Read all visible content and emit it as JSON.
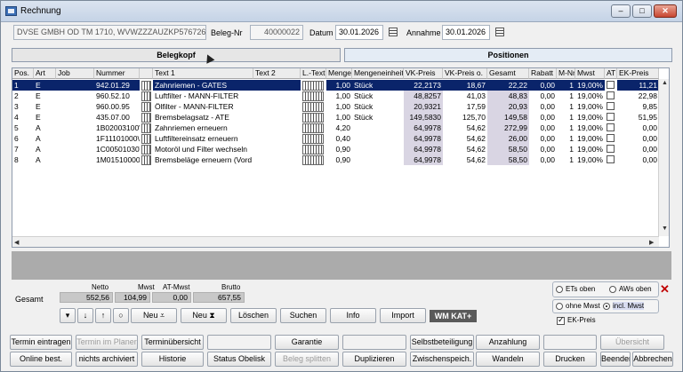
{
  "window": {
    "title": "Rechnung",
    "minimize": "–",
    "restore": "□",
    "close": "✕"
  },
  "header": {
    "customer": "DVSE GMBH OD TM 1710, WVWZZZAUZKP576726",
    "beleg_nr_label": "Beleg-Nr",
    "beleg_nr": "40000022",
    "datum_label": "Datum",
    "datum": "30.01.2026",
    "annahme_label": "Annahme",
    "annahme": "30.01.2026"
  },
  "tabs": {
    "belegkopf": "Belegkopf",
    "positionen": "Positionen"
  },
  "columns": [
    "Pos.",
    "Art",
    "Job",
    "Nummer",
    "",
    "Text 1",
    "Text 2",
    "L.-Text",
    "Menge",
    "Mengeneinheit",
    "VK-Preis",
    "VK-Preis o.",
    "Gesamt",
    "Rabatt",
    "M-Nr",
    "Mwst",
    "AT",
    "EK-Preis"
  ],
  "rows": [
    {
      "pos": "1",
      "art": "E",
      "nummer": "942.01.29",
      "text1": "Zahnriemen - GATES",
      "menge": "1,00",
      "einheit": "Stück",
      "vk": "22,2173",
      "vko": "18,67",
      "gesamt": "22,22",
      "rabatt": "0,00",
      "mnr": "1",
      "mwst": "19,00%",
      "ek": "11,21"
    },
    {
      "pos": "2",
      "art": "E",
      "nummer": "960.52.10",
      "text1": "Luftfilter - MANN-FILTER",
      "menge": "1,00",
      "einheit": "Stück",
      "vk": "48,8257",
      "vko": "41,03",
      "gesamt": "48,83",
      "rabatt": "0,00",
      "mnr": "1",
      "mwst": "19,00%",
      "ek": "22,98"
    },
    {
      "pos": "3",
      "art": "E",
      "nummer": "960.00.95",
      "text1": "Ölfilter - MANN-FILTER",
      "menge": "1,00",
      "einheit": "Stück",
      "vk": "20,9321",
      "vko": "17,59",
      "gesamt": "20,93",
      "rabatt": "0,00",
      "mnr": "1",
      "mwst": "19,00%",
      "ek": "9,85"
    },
    {
      "pos": "4",
      "art": "E",
      "nummer": "435.07.00",
      "text1": "Bremsbelagsatz - ATE",
      "menge": "1,00",
      "einheit": "Stück",
      "vk": "149,5830",
      "vko": "125,70",
      "gesamt": "149,58",
      "rabatt": "0,00",
      "mnr": "1",
      "mwst": "19,00%",
      "ek": "51,95"
    },
    {
      "pos": "5",
      "art": "A",
      "nummer": "1B02003100\\",
      "text1": "Zahnriemen erneuern",
      "menge": "4,20",
      "einheit": "",
      "vk": "64,9978",
      "vko": "54,62",
      "gesamt": "272,99",
      "rabatt": "0,00",
      "mnr": "1",
      "mwst": "19,00%",
      "ek": "0,00"
    },
    {
      "pos": "6",
      "art": "A",
      "nummer": "1F11101000\\",
      "text1": "Luftfiltereinsatz erneuern",
      "menge": "0,40",
      "einheit": "",
      "vk": "64,9978",
      "vko": "54,62",
      "gesamt": "26,00",
      "rabatt": "0,00",
      "mnr": "1",
      "mwst": "19,00%",
      "ek": "0,00"
    },
    {
      "pos": "7",
      "art": "A",
      "nummer": "1C00501030\\",
      "text1": "Motoröl und Filter wechseln",
      "menge": "0,90",
      "einheit": "",
      "vk": "64,9978",
      "vko": "54,62",
      "gesamt": "58,50",
      "rabatt": "0,00",
      "mnr": "1",
      "mwst": "19,00%",
      "ek": "0,00"
    },
    {
      "pos": "8",
      "art": "A",
      "nummer": "1M01510000\\",
      "text1": "Bremsbeläge erneuern (Vord",
      "menge": "0,90",
      "einheit": "",
      "vk": "64,9978",
      "vko": "54,62",
      "gesamt": "58,50",
      "rabatt": "0,00",
      "mnr": "1",
      "mwst": "19,00%",
      "ek": "0,00"
    }
  ],
  "totals": {
    "gesamt_label": "Gesamt",
    "netto_label": "Netto",
    "netto": "552,56",
    "mwst_label": "Mwst",
    "mwst": "104,99",
    "atmwst_label": "AT-Mwst",
    "atmwst": "0,00",
    "brutto_label": "Brutto",
    "brutto": "657,55"
  },
  "action_bar": {
    "dropdown": "▾",
    "down": "↓",
    "up": "↑",
    "circle": "○",
    "neu1": "Neu",
    "neu2": "Neu",
    "loeschen": "Löschen",
    "suchen": "Suchen",
    "info": "Info",
    "import": "Import",
    "wm_logo": "WM KAT+"
  },
  "options": {
    "ets_oben": "ETs oben",
    "aws_oben": "AWs oben",
    "ohne_mwst": "ohne Mwst",
    "incl_mwst": "incl. Mwst",
    "ek_preis": "EK-Preis"
  },
  "bottom1": {
    "termin_eintragen": "Termin eintragen",
    "termin_planer": "Termin im Planer",
    "terminuebersicht": "Terminübersicht",
    "garantie": "Garantie",
    "selbstbeteiligung": "Selbstbeteiligung",
    "anzahlung": "Anzahlung",
    "uebersicht": "Übersicht"
  },
  "bottom2": {
    "online_best": "Online best.",
    "nicht_archiviert": "nichts archiviert",
    "historie": "Historie",
    "status_obelisk": "Status Obelisk",
    "beleg_splitten": "Beleg splitten",
    "duplizieren": "Duplizieren",
    "zwischenspeich": "Zwischenspeich.",
    "wandeln": "Wandeln",
    "drucken": "Drucken",
    "beenden": "Beenden",
    "abbrechen": "Abbrechen"
  }
}
